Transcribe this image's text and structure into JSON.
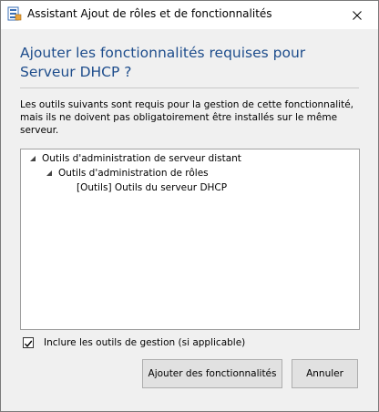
{
  "window": {
    "title": "Assistant Ajout de rôles et de fonctionnalités"
  },
  "dialog": {
    "heading": "Ajouter les fonctionnalités requises pour Serveur DHCP ?",
    "description": "Les outils suivants sont requis pour la gestion de cette fonctionnalité, mais ils ne doivent pas obligatoirement être installés sur le même serveur.",
    "tree": [
      {
        "label": "Outils d'administration de serveur distant",
        "expanded": true,
        "level": 0
      },
      {
        "label": "Outils d'administration de rôles",
        "expanded": true,
        "level": 1
      },
      {
        "label": "[Outils] Outils du serveur DHCP",
        "expanded": false,
        "level": 2
      }
    ],
    "include_tools": {
      "label": "Inclure les outils de gestion (si applicable)",
      "checked": true
    },
    "buttons": {
      "add_label": "Ajouter des fonctionnalités",
      "cancel_label": "Annuler"
    }
  },
  "icons": {
    "app": "server-manager-icon",
    "close": "close-icon",
    "expanded_arrow": "expanded-arrow-icon",
    "checkmark": "checkmark-icon"
  },
  "colors": {
    "heading": "#1e4d8c",
    "content_background": "#f0f0f0",
    "button_background": "#e1e1e1"
  }
}
